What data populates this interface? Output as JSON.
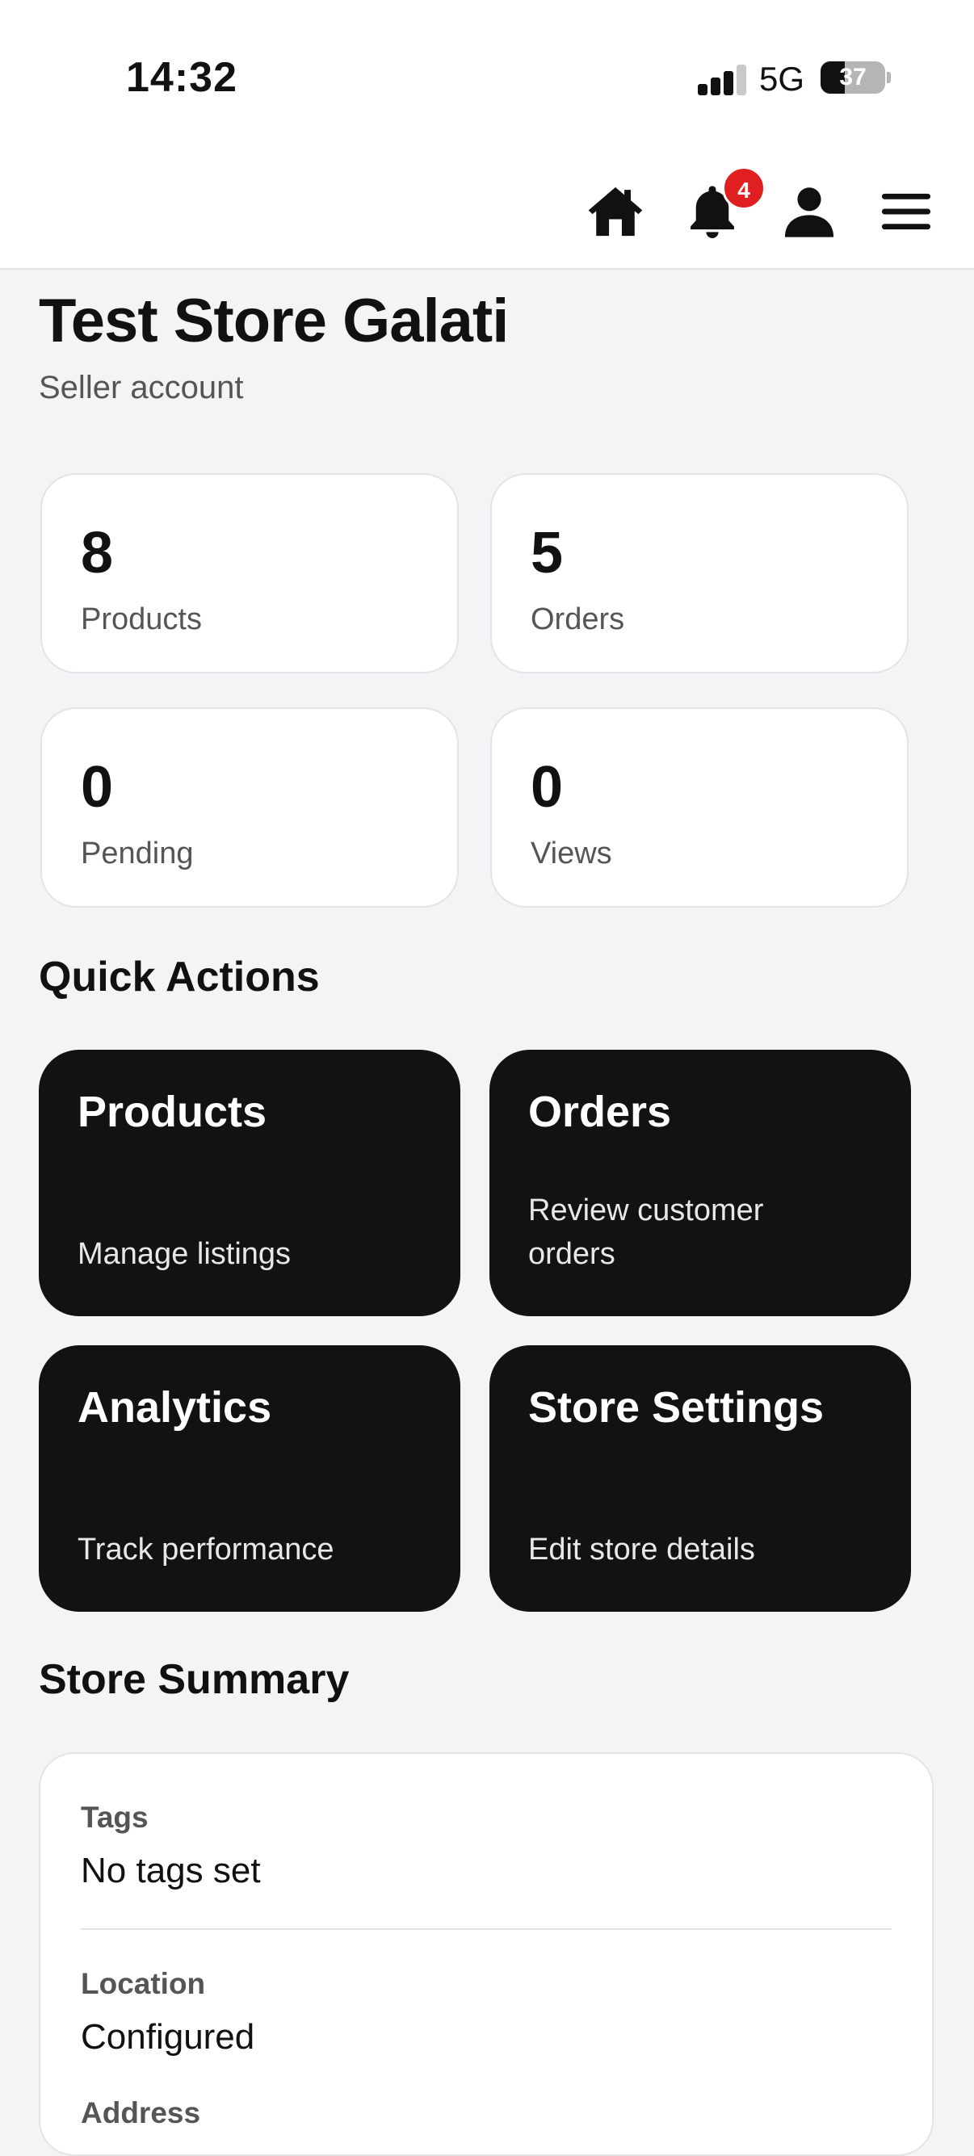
{
  "status_bar": {
    "time": "14:32",
    "network": "5G",
    "battery": "37",
    "battery_level": 0.37
  },
  "header": {
    "icons": [
      "home-icon",
      "bell-icon",
      "user-icon",
      "menu-icon"
    ],
    "notification_count": "4"
  },
  "page": {
    "title": "Test Store Galati",
    "subtitle": "Seller account"
  },
  "stats": [
    {
      "value": "8",
      "label": "Products"
    },
    {
      "value": "5",
      "label": "Orders"
    },
    {
      "value": "0",
      "label": "Pending"
    },
    {
      "value": "0",
      "label": "Views"
    }
  ],
  "quick_actions": {
    "heading": "Quick Actions",
    "items": [
      {
        "title": "Products",
        "description": "Manage listings"
      },
      {
        "title": "Orders",
        "description": "Review customer orders"
      },
      {
        "title": "Analytics",
        "description": "Track performance"
      },
      {
        "title": "Store Settings",
        "description": "Edit store details"
      }
    ]
  },
  "store_summary": {
    "heading": "Store Summary",
    "fields": [
      {
        "label": "Tags",
        "value": "No tags set"
      },
      {
        "label": "Location",
        "value": "Configured"
      },
      {
        "label": "Address",
        "value": ""
      }
    ]
  },
  "colors": {
    "badge": "#e02020",
    "action_card": "#121212",
    "background": "#f4f4f6"
  }
}
